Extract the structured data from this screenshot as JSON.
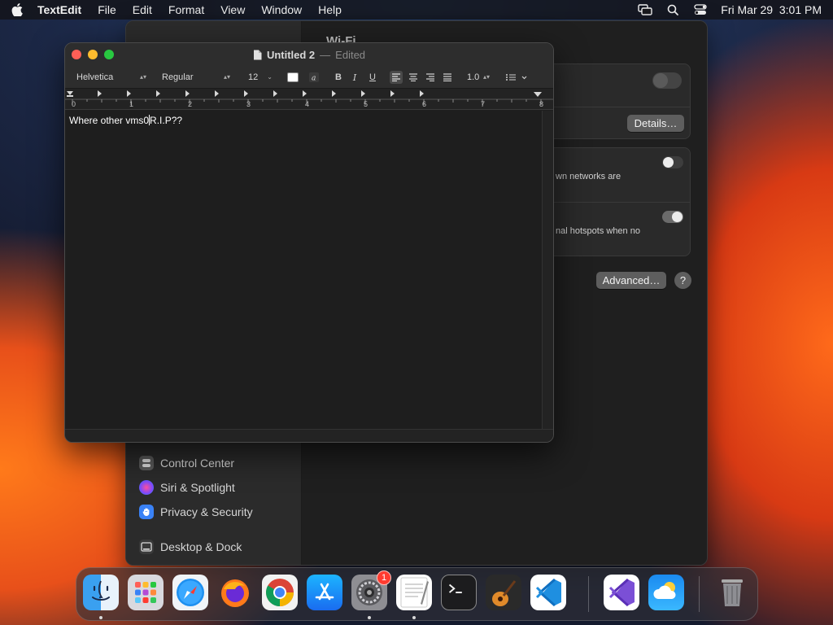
{
  "menubar": {
    "app_name": "TextEdit",
    "items": [
      "File",
      "Edit",
      "Format",
      "View",
      "Window",
      "Help"
    ],
    "clock": "Fri Mar 29  3:01 PM"
  },
  "settings": {
    "title": "Wi-Fi",
    "sidebar": {
      "items": [
        {
          "label": "Control Center",
          "icon": "control-center-icon",
          "color": "#6a6a6a"
        },
        {
          "label": "Siri & Spotlight",
          "icon": "siri-icon",
          "color": "#b44bd6"
        },
        {
          "label": "Privacy & Security",
          "icon": "hand-icon",
          "color": "#3a82f6"
        },
        {
          "label": "Desktop & Dock",
          "icon": "desktop-icon",
          "color": "#3a3a3a"
        }
      ]
    },
    "details_button": "Details…",
    "known_networks_text": "wn networks are",
    "hotspots_text": "nal hotspots when no",
    "advanced_button": "Advanced…",
    "help_button": "?"
  },
  "textedit": {
    "title": "Untitled 2",
    "separator": "—",
    "status": "Edited",
    "toolbar": {
      "font_family": "Helvetica",
      "font_style": "Regular",
      "font_size": "12",
      "bold": "B",
      "italic": "I",
      "underline": "U",
      "line_spacing": "1.0"
    },
    "ruler_numbers": [
      "0",
      "1",
      "2",
      "3",
      "4",
      "5",
      "6",
      "7",
      "8"
    ],
    "document_text_before_cursor": "Where other vms0",
    "document_text_after_cursor": "R.I.P??"
  },
  "dock": {
    "apps": [
      {
        "name": "Finder",
        "icon": "finder-icon",
        "running": true
      },
      {
        "name": "Launchpad",
        "icon": "launchpad-icon",
        "running": false
      },
      {
        "name": "Safari",
        "icon": "safari-icon",
        "running": false
      },
      {
        "name": "Firefox",
        "icon": "firefox-icon",
        "running": false
      },
      {
        "name": "Chrome",
        "icon": "chrome-icon",
        "running": false
      },
      {
        "name": "App Store",
        "icon": "app-store-icon",
        "running": false
      },
      {
        "name": "System Settings",
        "icon": "system-settings-icon",
        "running": true,
        "badge": "1"
      },
      {
        "name": "TextEdit",
        "icon": "textedit-icon",
        "running": true
      },
      {
        "name": "Terminal",
        "icon": "terminal-icon",
        "running": false
      },
      {
        "name": "GarageBand",
        "icon": "garageband-icon",
        "running": false
      },
      {
        "name": "Visual Studio Code",
        "icon": "vscode-icon",
        "running": false
      },
      {
        "name": "Visual Studio",
        "icon": "visual-studio-icon",
        "running": false
      },
      {
        "name": "Weather",
        "icon": "weather-icon",
        "running": false
      },
      {
        "name": "Trash",
        "icon": "trash-icon",
        "running": false
      }
    ]
  }
}
